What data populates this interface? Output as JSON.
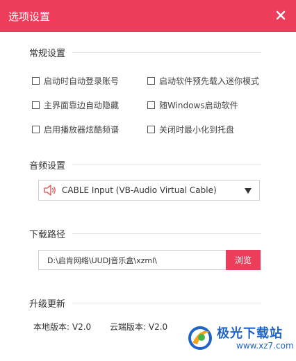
{
  "window": {
    "title": "选项设置"
  },
  "sections": {
    "general": "常规设置",
    "audio": "音频设置",
    "download": "下载路径",
    "update": "升级更新"
  },
  "general_options": [
    {
      "label": "启动时自动登录账号",
      "checked": false
    },
    {
      "label": "启动软件预先载入迷你模式",
      "checked": false
    },
    {
      "label": "主界面靠边自动隐藏",
      "checked": false
    },
    {
      "label": "随Windows启动软件",
      "checked": false
    },
    {
      "label": "启用播放器炫酷频谱",
      "checked": false
    },
    {
      "label": "关闭时最小化到托盘",
      "checked": false
    }
  ],
  "audio": {
    "device": "CABLE Input (VB-Audio Virtual Cable)"
  },
  "download": {
    "path": "D:\\启肯网络\\UUDJ音乐盒\\xzml\\",
    "browse_label": "浏览"
  },
  "update": {
    "local_version": "本地版本: V2.0",
    "cloud_version": "云端版本: V2.0"
  },
  "watermark": {
    "name": "极光下载站",
    "url": "www.xz7.com"
  },
  "colors": {
    "accent": "#ec3e5a",
    "watermark": "#1f63c8"
  },
  "icons": {
    "close": "close-icon",
    "speaker": "speaker-icon",
    "dropdown": "triangle-down-icon"
  }
}
